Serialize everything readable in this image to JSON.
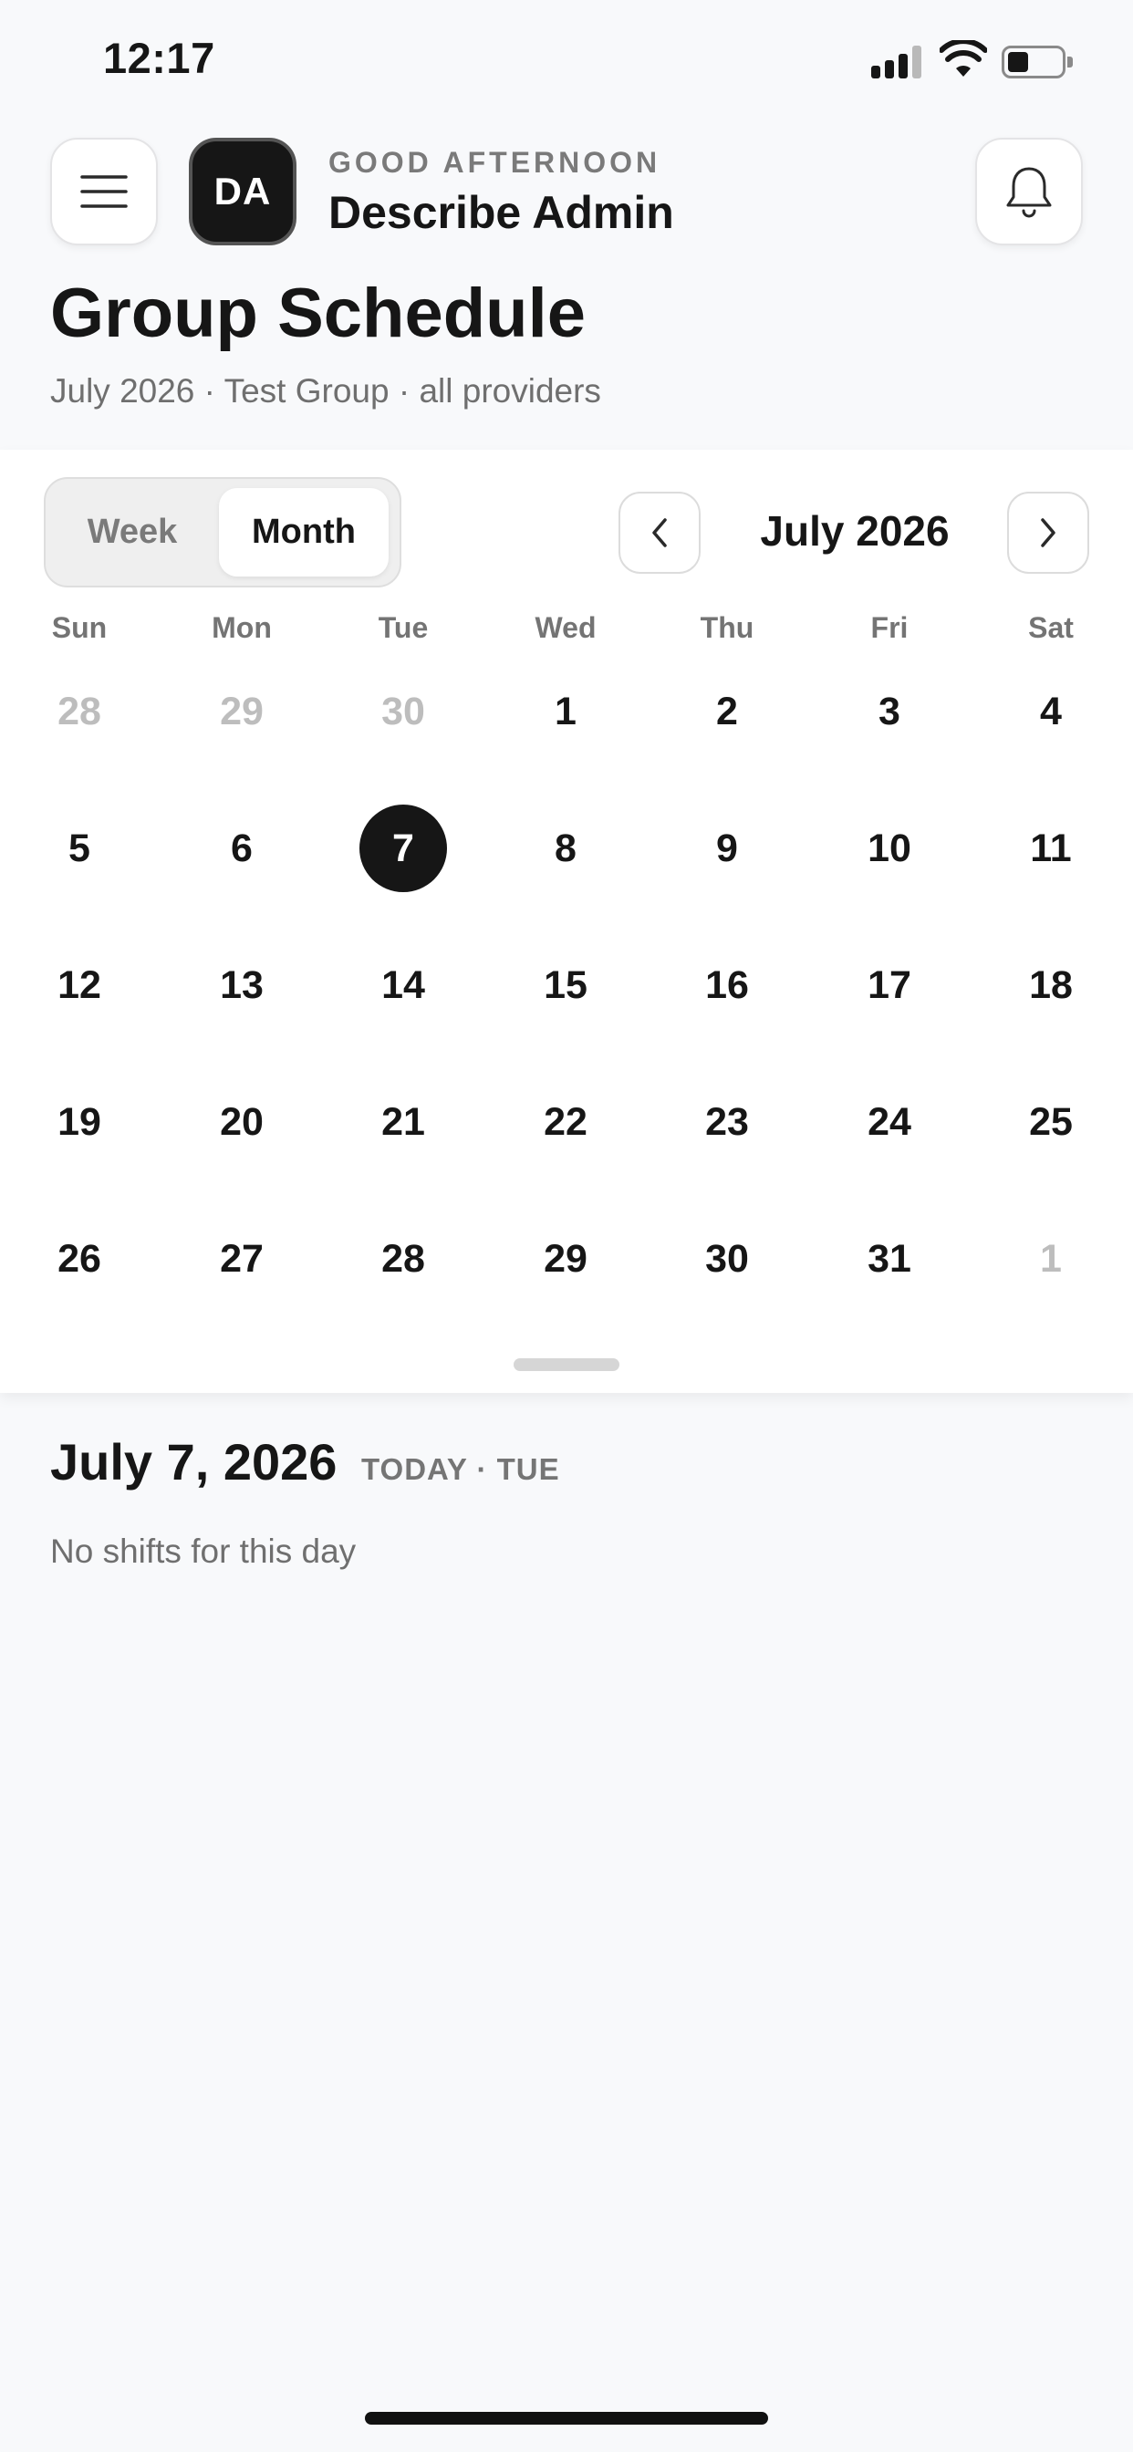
{
  "status_bar": {
    "time": "12:17",
    "icons": [
      "cellular-signal-icon",
      "wifi-icon",
      "battery-icon"
    ]
  },
  "header": {
    "menu_icon": "hamburger-menu-icon",
    "avatar_initials": "DA",
    "greeting": "GOOD AFTERNOON",
    "user_name": "Describe Admin",
    "notification_icon": "bell-icon"
  },
  "page": {
    "title": "Group Schedule",
    "subtitle": "July 2026 · Test Group · all providers"
  },
  "calendar": {
    "view_options": [
      "Week",
      "Month"
    ],
    "selected_view": "Month",
    "month_label": "July 2026",
    "weekdays": [
      "Sun",
      "Mon",
      "Tue",
      "Wed",
      "Thu",
      "Fri",
      "Sat"
    ],
    "weeks": [
      [
        {
          "d": "28",
          "muted": true
        },
        {
          "d": "29",
          "muted": true
        },
        {
          "d": "30",
          "muted": true
        },
        {
          "d": "1"
        },
        {
          "d": "2"
        },
        {
          "d": "3"
        },
        {
          "d": "4"
        }
      ],
      [
        {
          "d": "5"
        },
        {
          "d": "6"
        },
        {
          "d": "7",
          "selected": true
        },
        {
          "d": "8"
        },
        {
          "d": "9"
        },
        {
          "d": "10"
        },
        {
          "d": "11"
        }
      ],
      [
        {
          "d": "12"
        },
        {
          "d": "13"
        },
        {
          "d": "14"
        },
        {
          "d": "15"
        },
        {
          "d": "16"
        },
        {
          "d": "17"
        },
        {
          "d": "18"
        }
      ],
      [
        {
          "d": "19"
        },
        {
          "d": "20"
        },
        {
          "d": "21"
        },
        {
          "d": "22"
        },
        {
          "d": "23"
        },
        {
          "d": "24"
        },
        {
          "d": "25"
        }
      ],
      [
        {
          "d": "26"
        },
        {
          "d": "27"
        },
        {
          "d": "28"
        },
        {
          "d": "29"
        },
        {
          "d": "30"
        },
        {
          "d": "31"
        },
        {
          "d": "1",
          "muted": true
        }
      ]
    ],
    "selected_color": "#161616"
  },
  "selected_day": {
    "date": "July 7, 2026",
    "meta": "TODAY · TUE",
    "empty_message": "No shifts for this day"
  }
}
